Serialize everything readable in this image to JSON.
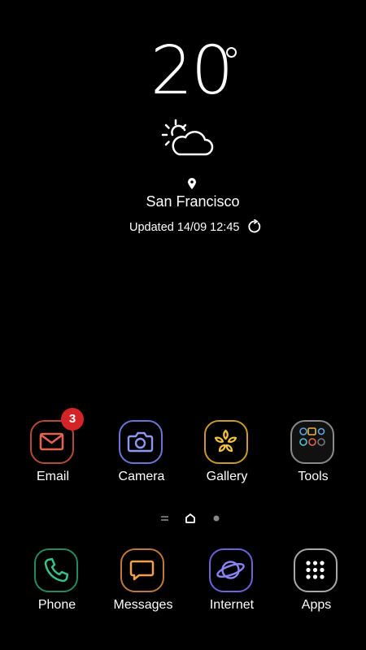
{
  "weather": {
    "temperature": "20",
    "city": "San Francisco",
    "updated": "Updated 14/09 12:45",
    "condition_icon": "partly-cloudy-icon"
  },
  "home_apps": [
    {
      "label": "Email",
      "icon": "email-icon",
      "color": "#e2624f",
      "badge": "3"
    },
    {
      "label": "Camera",
      "icon": "camera-icon",
      "color": "#7b86e6"
    },
    {
      "label": "Gallery",
      "icon": "gallery-flower-icon",
      "color": "#e8b63c"
    },
    {
      "label": "Tools",
      "icon": "folder-icon",
      "color": "#9a9a9a"
    }
  ],
  "dock_apps": [
    {
      "label": "Phone",
      "icon": "phone-icon",
      "color": "#2fae7a"
    },
    {
      "label": "Messages",
      "icon": "message-icon",
      "color": "#e8954a"
    },
    {
      "label": "Internet",
      "icon": "globe-planet-icon",
      "color": "#7d73e8"
    },
    {
      "label": "Apps",
      "icon": "apps-grid-icon",
      "color": "#c8c8c8"
    }
  ],
  "page_indicator": {
    "current": "home",
    "pages": [
      "menu",
      "home",
      "page"
    ]
  }
}
